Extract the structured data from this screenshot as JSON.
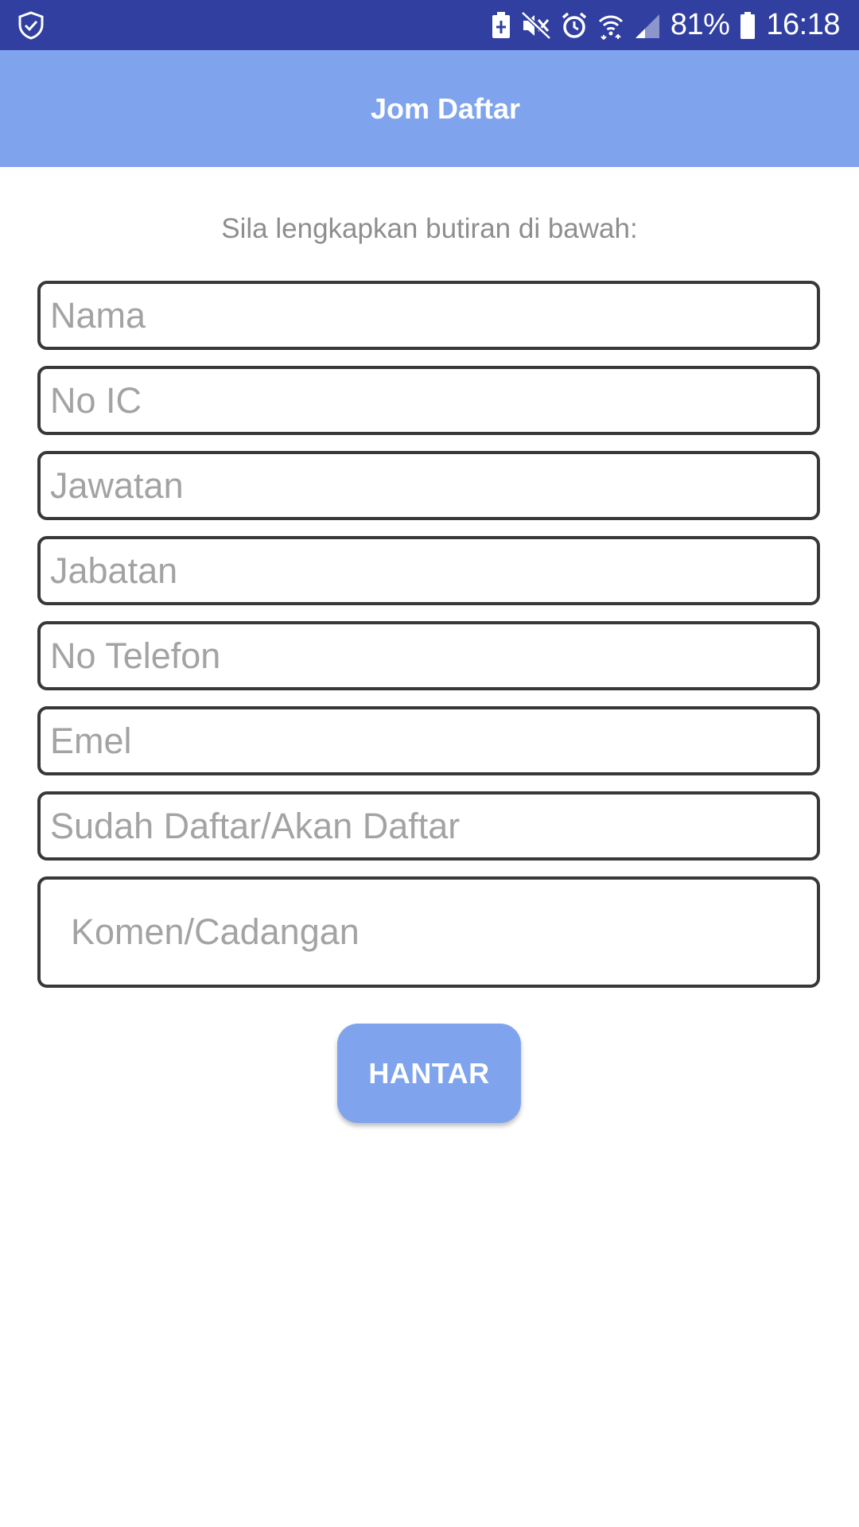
{
  "status_bar": {
    "battery_percent": "81%",
    "time": "16:18",
    "icons": [
      "shield-check-icon",
      "battery-saver-icon",
      "mute-icon",
      "alarm-icon",
      "wifi-icon",
      "signal-icon",
      "battery-icon"
    ]
  },
  "app_bar": {
    "title": "Jom Daftar"
  },
  "form": {
    "instruction": "Sila lengkapkan butiran di bawah:",
    "fields": [
      {
        "placeholder": "Nama",
        "value": ""
      },
      {
        "placeholder": "No IC",
        "value": ""
      },
      {
        "placeholder": "Jawatan",
        "value": ""
      },
      {
        "placeholder": "Jabatan",
        "value": ""
      },
      {
        "placeholder": "No Telefon",
        "value": ""
      },
      {
        "placeholder": "Emel",
        "value": ""
      },
      {
        "placeholder": "Sudah Daftar/Akan Daftar",
        "value": ""
      },
      {
        "placeholder": "Komen/Cadangan",
        "value": ""
      }
    ],
    "submit_label": "HANTAR"
  },
  "colors": {
    "status_bar": "#303fa0",
    "accent": "#7fa3ec",
    "field_border": "#383838",
    "placeholder": "#a3a3a3",
    "instruction_text": "#8e8e8e"
  }
}
